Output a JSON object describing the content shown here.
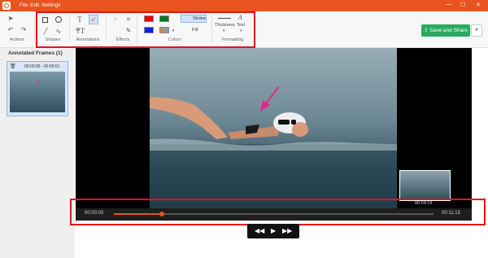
{
  "menu": [
    "File",
    "Edit",
    "Settings"
  ],
  "window": {
    "minimize": "—",
    "maximize": "☐",
    "close": "✕"
  },
  "ribbon": {
    "groups": {
      "actions": "Actions",
      "shapes": "Shapes",
      "annotations": "Annotations",
      "effects": "Effects",
      "colors": "Colors",
      "formatting": "Formatting"
    },
    "stroke_label": "Stroke",
    "fill_label": "Fill",
    "thickness_label": "Thickness",
    "text_label": "Text",
    "save_label": "Save and Share",
    "colors": {
      "red": "#e00000",
      "green": "#007a1e",
      "blue": "#1020e0",
      "accent": "#e8531f"
    }
  },
  "sidebar": {
    "title": "Annotated Frames (1)",
    "frame_time": "00:00:00 - 00:00:01"
  },
  "video": {
    "pip_time": "00:04:19"
  },
  "timeline": {
    "start": "00:00:00",
    "end": "00:11:15",
    "progress": 0.15
  },
  "icons": [
    "app-logo",
    "cursor-icon",
    "undo-icon",
    "redo-icon",
    "rectangle-icon",
    "circle-icon",
    "line-icon",
    "freehand-icon",
    "text-icon",
    "arrow-icon",
    "textbox-icon",
    "blur-icon",
    "crop-icon",
    "highlight-icon",
    "upload-icon",
    "rewind-icon",
    "play-icon",
    "fast-forward-icon"
  ]
}
